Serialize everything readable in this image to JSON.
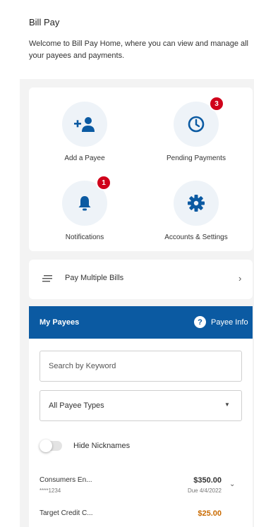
{
  "header": {
    "title": "Bill Pay",
    "welcome": "Welcome to Bill Pay Home, where you can view and manage all your payees and payments."
  },
  "actions": [
    {
      "label": "Add a Payee",
      "icon": "add-person-icon"
    },
    {
      "label": "Pending Payments",
      "icon": "clock-icon",
      "badge": "3"
    },
    {
      "label": "Notifications",
      "icon": "bell-icon",
      "badge": "1"
    },
    {
      "label": "Accounts & Settings",
      "icon": "gear-icon"
    }
  ],
  "pay_multiple": {
    "label": "Pay Multiple Bills",
    "icon": "lines-icon"
  },
  "payees": {
    "title": "My Payees",
    "info_label": "Payee Info",
    "search_placeholder": "Search by Keyword",
    "filter_value": "All Payee Types",
    "toggle_label": "Hide Nicknames",
    "toggle_on": false,
    "rows": [
      {
        "name": "Consumers En...",
        "account": "****1234",
        "amount": "$350.00",
        "due": "Due 4/4/2022"
      },
      {
        "name": "Target Credit C...",
        "account": "",
        "amount": "$25.00",
        "due": ""
      }
    ]
  },
  "colors": {
    "brand_blue": "#0b5aa2",
    "badge_red": "#d0021b",
    "amount_orange": "#c96a00"
  }
}
